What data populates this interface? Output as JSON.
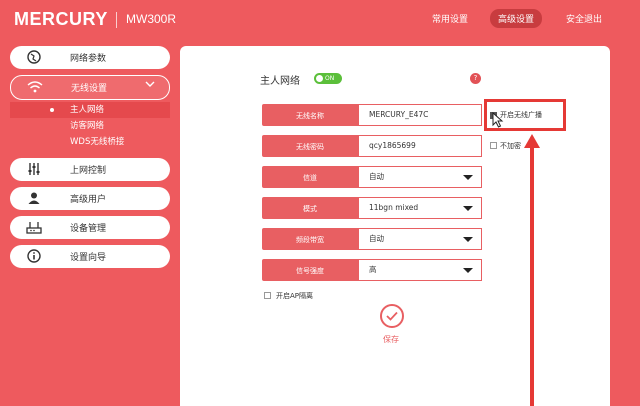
{
  "brand": {
    "logo": "MERCURY",
    "model": "MW300R"
  },
  "topnav": {
    "common": "常用设置",
    "advanced": "高级设置",
    "logout": "安全退出"
  },
  "sidebar": {
    "network": "网络参数",
    "wireless": "无线设置",
    "wireless_sub": [
      "主人网络",
      "访客网络",
      "WDS无线桥接"
    ],
    "internet_control": "上网控制",
    "advanced_user": "高级用户",
    "device_mgmt": "设备管理",
    "wizard": "设置向导"
  },
  "form": {
    "title": "主人网络",
    "toggle": "ON",
    "fields": [
      {
        "label": "无线名称",
        "value": "MERCURY_E47C"
      },
      {
        "label": "无线密码",
        "value": "qcy1865699"
      },
      {
        "label": "信道",
        "value": "自动"
      },
      {
        "label": "模式",
        "value": "11bgn mixed"
      },
      {
        "label": "频段带宽",
        "value": "自动"
      },
      {
        "label": "信号强度",
        "value": "高"
      }
    ],
    "broadcast_label": "开启无线广播",
    "broadcast_checked": true,
    "no_encrypt_label": "不加密",
    "ap_isolation_label": "开启AP隔离",
    "save_label": "保存"
  },
  "colors": {
    "accent": "#ee5a5e",
    "highlight": "#e53935"
  }
}
